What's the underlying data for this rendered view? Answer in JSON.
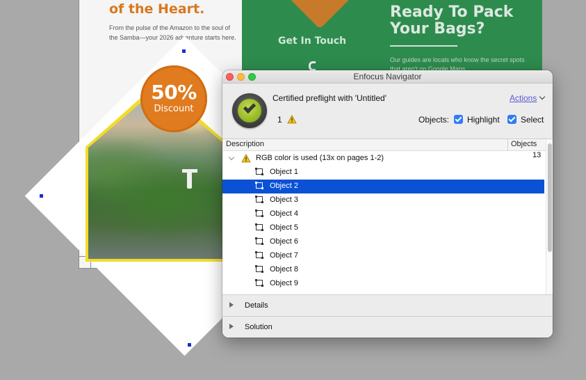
{
  "app": {
    "window_title": "Enfocus Navigator"
  },
  "background_doc": {
    "headline": "of the Heart.",
    "body": "From the pulse of the Amazon to the soul of the Samba—your 2026 adventure starts here.",
    "get_in_touch": "Get In Touch",
    "ready_title": "Ready To Pack Your Bags?",
    "ready_body": "Our guides are locals who know the secret spots that aren't on Google Maps",
    "badge_percent": "50%",
    "badge_label": "Discount"
  },
  "header": {
    "report_title": "Certified preflight with 'Untitled'",
    "actions_label": "Actions",
    "warning_count": "1",
    "objects_label": "Objects:",
    "highlight_label": "Highlight",
    "highlight_checked": true,
    "select_label": "Select",
    "select_checked": true
  },
  "table": {
    "columns": [
      "Description",
      "Objects"
    ],
    "group": {
      "label": "RGB color is used (13x on pages 1-2)",
      "count": "13",
      "expanded": true
    },
    "objects": [
      {
        "label": "Object 1",
        "selected": false
      },
      {
        "label": "Object 2",
        "selected": true
      },
      {
        "label": "Object 3",
        "selected": false
      },
      {
        "label": "Object 4",
        "selected": false
      },
      {
        "label": "Object 5",
        "selected": false
      },
      {
        "label": "Object 6",
        "selected": false
      },
      {
        "label": "Object 7",
        "selected": false
      },
      {
        "label": "Object 8",
        "selected": false
      },
      {
        "label": "Object 9",
        "selected": false
      }
    ]
  },
  "sections": {
    "details": "Details",
    "solution": "Solution"
  },
  "colors": {
    "selection": "#0a51d6",
    "accent_orange": "#e07b1f",
    "green_panel": "#2e8b4e",
    "link": "#5a57d6"
  }
}
